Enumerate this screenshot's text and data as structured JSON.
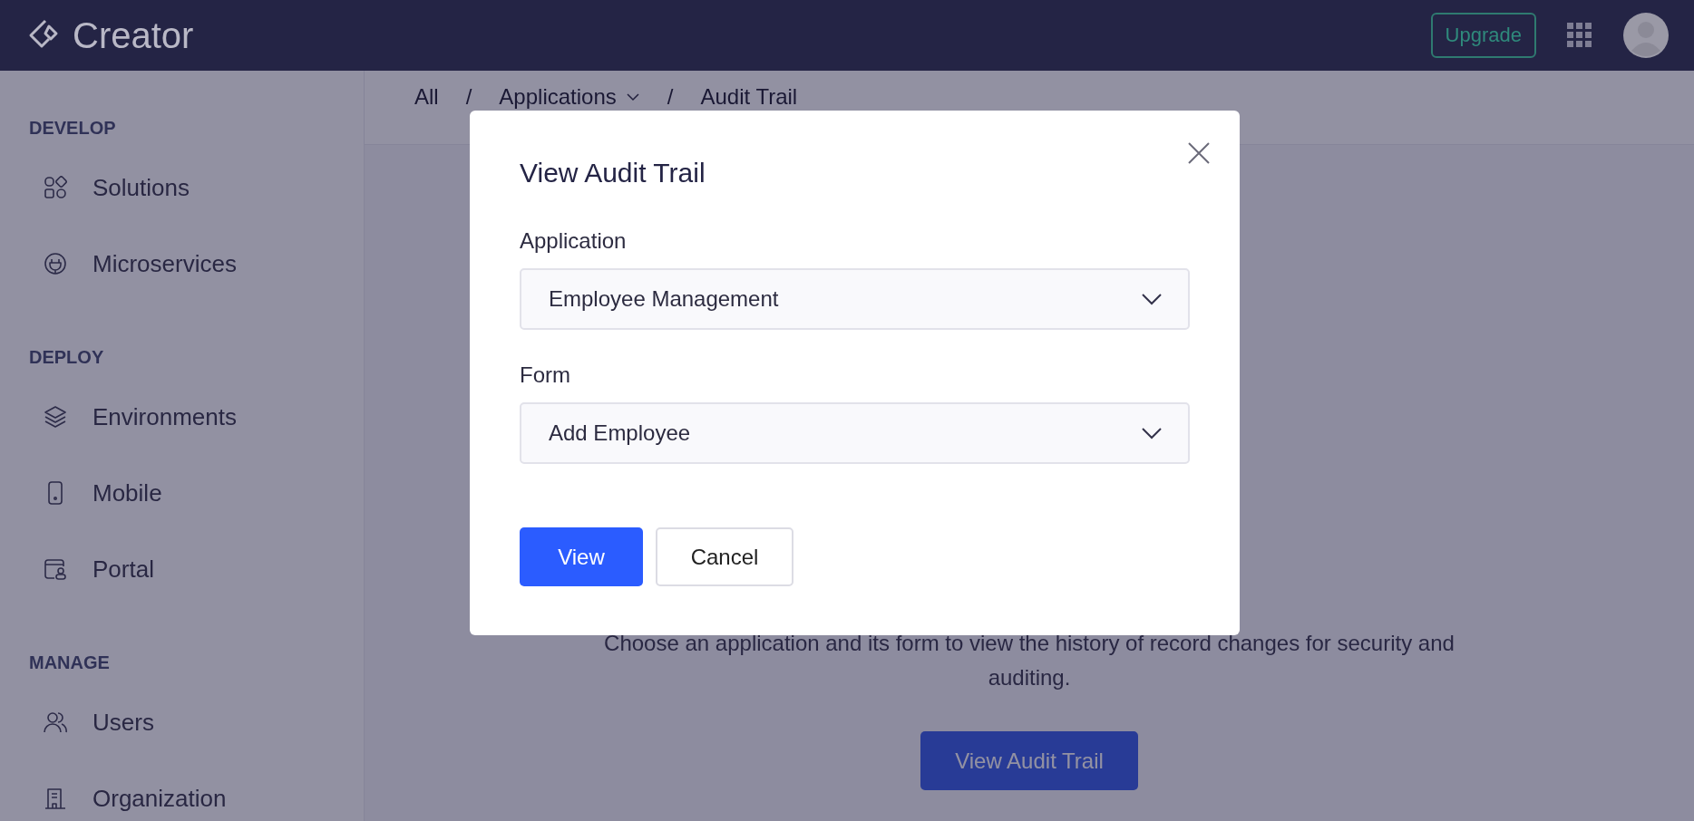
{
  "header": {
    "logo_text": "Creator",
    "upgrade": "Upgrade"
  },
  "sidebar": {
    "sections": [
      {
        "title": "DEVELOP",
        "items": [
          {
            "label": "Solutions"
          },
          {
            "label": "Microservices"
          }
        ]
      },
      {
        "title": "DEPLOY",
        "items": [
          {
            "label": "Environments"
          },
          {
            "label": "Mobile"
          },
          {
            "label": "Portal"
          }
        ]
      },
      {
        "title": "MANAGE",
        "items": [
          {
            "label": "Users"
          },
          {
            "label": "Organization"
          }
        ]
      }
    ]
  },
  "breadcrumb": [
    {
      "label": "All",
      "dropdown": false
    },
    {
      "label": "Applications",
      "dropdown": true
    },
    {
      "label": "Audit Trail",
      "dropdown": false
    }
  ],
  "separator": "/",
  "main": {
    "description": "Choose an application and its form to view the history of record changes for security and auditing.",
    "button": "View Audit Trail"
  },
  "dialog": {
    "title": "View Audit Trail",
    "fields": [
      {
        "label": "Application",
        "value": "Employee Management"
      },
      {
        "label": "Form",
        "value": "Add Employee"
      }
    ],
    "primary": "View",
    "secondary": "Cancel"
  }
}
